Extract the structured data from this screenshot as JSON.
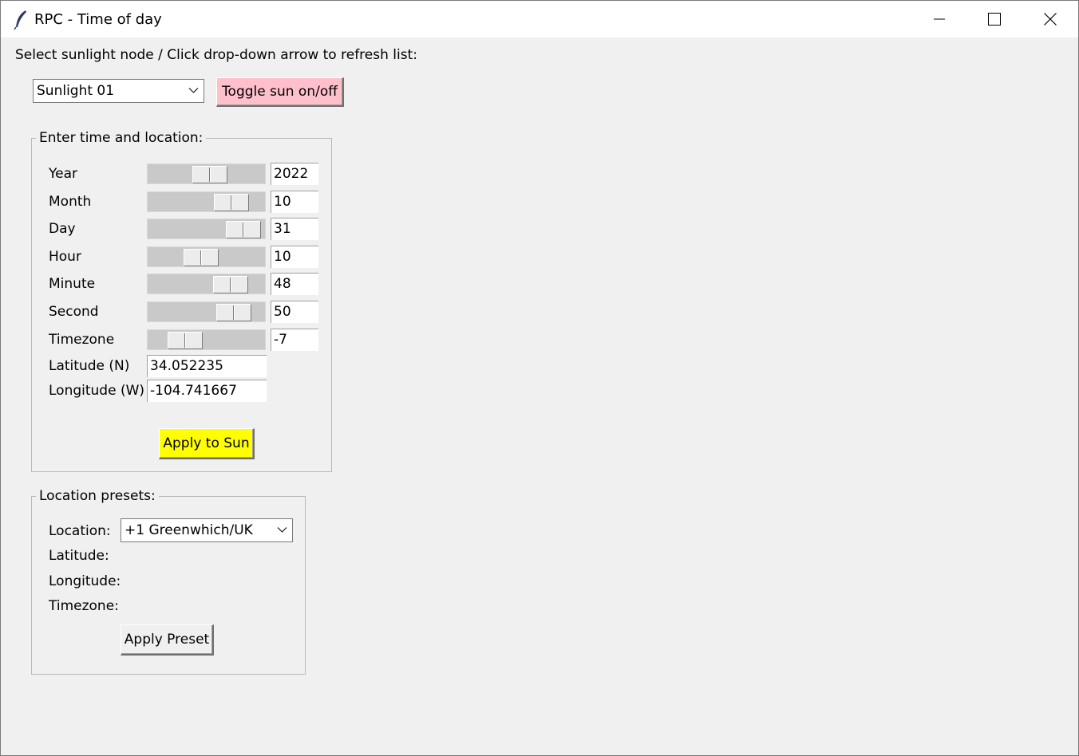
{
  "window": {
    "title": "RPC - Time of day"
  },
  "header": {
    "instruction": "Select sunlight node / Click drop-down arrow to refresh list:",
    "node_select": {
      "value": "Sunlight 01"
    },
    "toggle_label": "Toggle sun on/off",
    "toggle_color": "#ffc0cb"
  },
  "time_location": {
    "title": "Enter time and location:",
    "sliders": [
      {
        "label": "Year",
        "value": "2022",
        "level": 0.55
      },
      {
        "label": "Month",
        "value": "10",
        "level": 0.82
      },
      {
        "label": "Day",
        "value": "31",
        "level": 0.97
      },
      {
        "label": "Hour",
        "value": "10",
        "level": 0.43
      },
      {
        "label": "Minute",
        "value": "48",
        "level": 0.81
      },
      {
        "label": "Second",
        "value": "50",
        "level": 0.85
      },
      {
        "label": "Timezone",
        "value": "-7",
        "level": 0.23
      }
    ],
    "latitude": {
      "label": "Latitude (N)",
      "value": "34.052235"
    },
    "longitude": {
      "label": "Longitude (W)",
      "value": "-104.741667"
    },
    "apply_label": "Apply to Sun",
    "apply_color": "#ffff00"
  },
  "presets": {
    "title": "Location presets:",
    "location_label": "Location:",
    "location_value": "+1 Greenwhich/UK",
    "latitude_label": "Latitude:",
    "longitude_label": "Longitude:",
    "timezone_label": "Timezone:",
    "apply_label": "Apply Preset"
  }
}
